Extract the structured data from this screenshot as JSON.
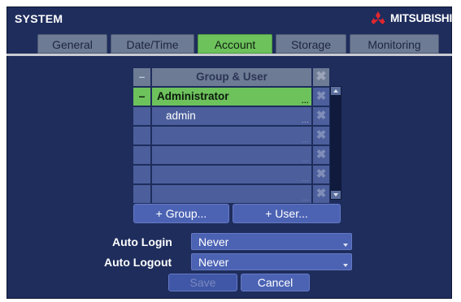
{
  "window": {
    "title": "SYSTEM",
    "brand": "MITSUBISHI"
  },
  "tabs": [
    "General",
    "Date/Time",
    "Account",
    "Storage",
    "Monitoring"
  ],
  "active_tab": "Account",
  "table": {
    "collapse_symbol": "–",
    "header": "Group & User",
    "delete_symbol": "✖",
    "rows": [
      {
        "collapse": "–",
        "label": "Administrator",
        "dots": "...",
        "selected": true
      },
      {
        "collapse": "",
        "label": "admin",
        "dots": "...",
        "selected": false
      },
      {
        "collapse": "",
        "label": "",
        "dots": "...",
        "selected": false
      },
      {
        "collapse": "",
        "label": "",
        "dots": "...",
        "selected": false
      },
      {
        "collapse": "",
        "label": "",
        "dots": "...",
        "selected": false
      },
      {
        "collapse": "",
        "label": "",
        "dots": "...",
        "selected": false
      }
    ]
  },
  "buttons": {
    "add_group": "+ Group...",
    "add_user": "+ User...",
    "save": "Save",
    "cancel": "Cancel"
  },
  "settings": {
    "auto_login": {
      "label": "Auto Login",
      "value": "Never"
    },
    "auto_logout": {
      "label": "Auto Logout",
      "value": "Never"
    }
  },
  "colors": {
    "background": "#1e2d5c",
    "tab": "#6e7b95",
    "active": "#6dc25c",
    "row": "#4c5f9c",
    "button": "#4c63b4",
    "brand": "#e0262e"
  },
  "icons": {
    "logo": "mitsubishi-diamonds-icon",
    "delete": "delete-x-icon",
    "scroll_up": "arrow-up-icon",
    "scroll_down": "arrow-down-icon",
    "dropdown": "chevron-down-icon"
  }
}
